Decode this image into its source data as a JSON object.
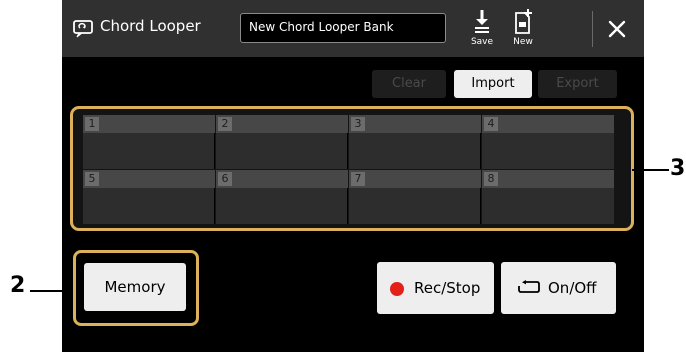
{
  "colors": {
    "accent": "#ddb15a",
    "background": "#000000",
    "titlebar": "#303030",
    "button": "#eeeeee",
    "rec_dot": "#e32119"
  },
  "titlebar": {
    "icon": "chord-looper-icon",
    "title": "Chord Looper",
    "bank_name": "New Chord Looper Bank",
    "save_label": "Save",
    "new_label": "New",
    "close_icon": "close-icon"
  },
  "actions": {
    "clear_label": "Clear",
    "import_label": "Import",
    "export_label": "Export"
  },
  "memories": [
    {
      "number": "1"
    },
    {
      "number": "2"
    },
    {
      "number": "3"
    },
    {
      "number": "4"
    },
    {
      "number": "5"
    },
    {
      "number": "6"
    },
    {
      "number": "7"
    },
    {
      "number": "8"
    }
  ],
  "bottom": {
    "memory_label": "Memory",
    "recstop_label": "Rec/Stop",
    "onoff_label": "On/Off"
  },
  "callouts": {
    "memory": "2",
    "grid": "3"
  }
}
